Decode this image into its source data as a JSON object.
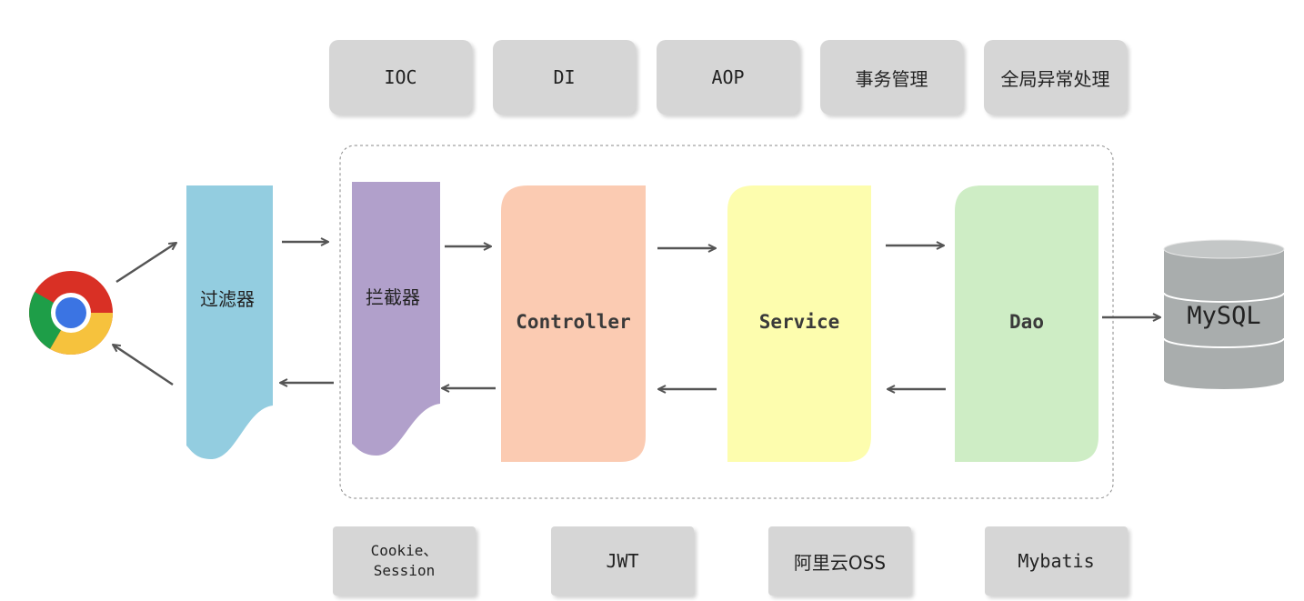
{
  "top_features": [
    "IOC",
    "DI",
    "AOP",
    "事务管理",
    "全局异常处理"
  ],
  "flow": {
    "filter": "过滤器",
    "interceptor": "拦截器",
    "controller": "Controller",
    "service": "Service",
    "dao": "Dao",
    "database": "MySQL"
  },
  "bottom_features": [
    "Cookie、\nSession",
    "JWT",
    "阿里云OSS",
    "Mybatis"
  ],
  "colors": {
    "filter": "#93cde0",
    "interceptor": "#b1a0cb",
    "controller": "#fbcbb2",
    "service": "#fdfdae",
    "dao": "#ceedc5",
    "database": "#a9adad",
    "box": "#d6d6d6"
  },
  "icons": {
    "browser": "chrome-icon",
    "cursor": "mouse-cursor-icon"
  }
}
